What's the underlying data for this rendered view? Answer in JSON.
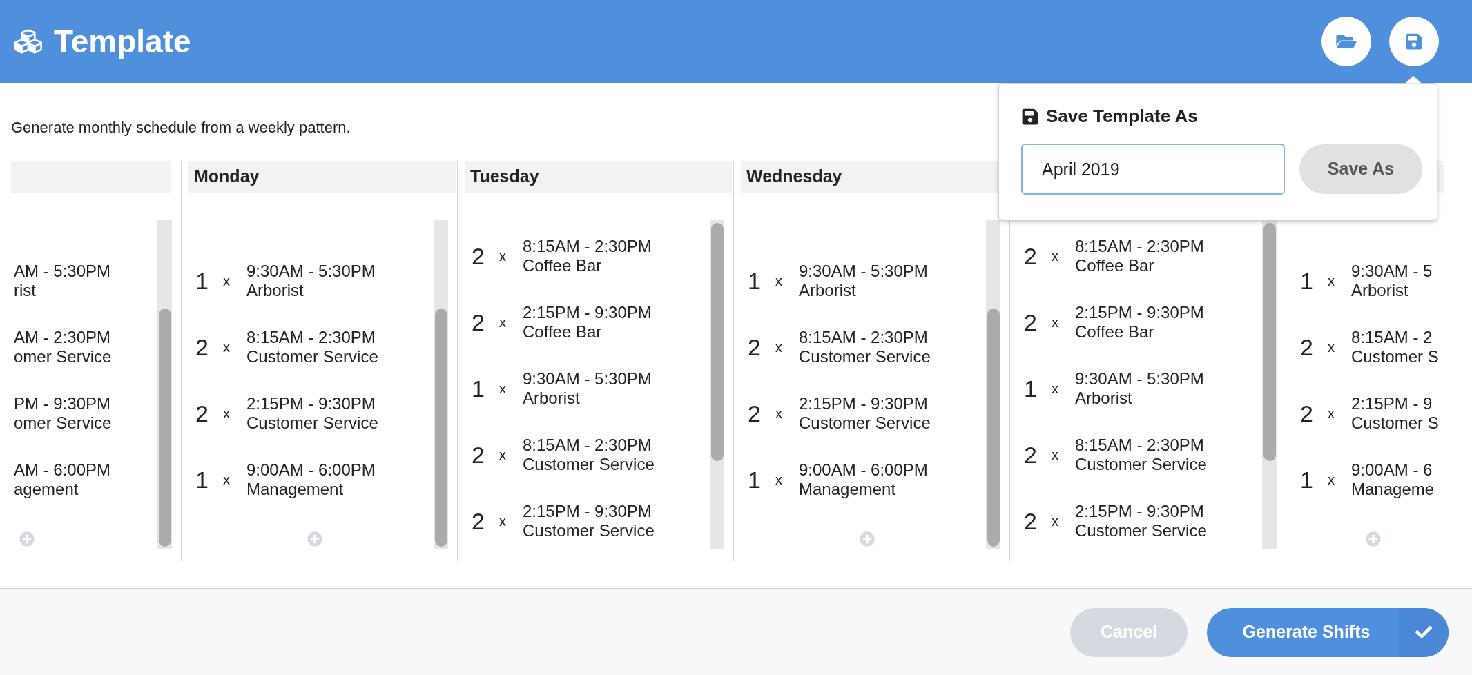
{
  "header": {
    "title": "Template"
  },
  "description": "Generate monthly schedule from a weekly pattern.",
  "columns": [
    {
      "kind": "clipped-left",
      "add_button": true,
      "shifts": [
        {
          "time": "AM - 5:30PM",
          "role": "rist"
        },
        {
          "time": "AM - 2:30PM",
          "role": "omer Service"
        },
        {
          "time": "PM - 9:30PM",
          "role": "omer Service"
        },
        {
          "time": "AM - 6:00PM",
          "role": "agement"
        }
      ]
    },
    {
      "kind": "full",
      "heading": "Monday",
      "add_button": true,
      "shifts": [
        {
          "count": "1",
          "multiplier": "x",
          "time": "9:30AM - 5:30PM",
          "role": "Arborist"
        },
        {
          "count": "2",
          "multiplier": "x",
          "time": "8:15AM - 2:30PM",
          "role": "Customer Service"
        },
        {
          "count": "2",
          "multiplier": "x",
          "time": "2:15PM - 9:30PM",
          "role": "Customer Service"
        },
        {
          "count": "1",
          "multiplier": "x",
          "time": "9:00AM - 6:00PM",
          "role": "Management"
        }
      ]
    },
    {
      "kind": "full",
      "heading": "Tuesday",
      "add_button": false,
      "shifts": [
        {
          "count": "2",
          "multiplier": "x",
          "time": "8:15AM - 2:30PM",
          "role": "Coffee Bar"
        },
        {
          "count": "2",
          "multiplier": "x",
          "time": "2:15PM - 9:30PM",
          "role": "Coffee Bar"
        },
        {
          "count": "1",
          "multiplier": "x",
          "time": "9:30AM - 5:30PM",
          "role": "Arborist"
        },
        {
          "count": "2",
          "multiplier": "x",
          "time": "8:15AM - 2:30PM",
          "role": "Customer Service"
        },
        {
          "count": "2",
          "multiplier": "x",
          "time": "2:15PM - 9:30PM",
          "role": "Customer Service"
        }
      ]
    },
    {
      "kind": "full",
      "heading": "Wednesday",
      "add_button": true,
      "shifts": [
        {
          "count": "1",
          "multiplier": "x",
          "time": "9:30AM - 5:30PM",
          "role": "Arborist"
        },
        {
          "count": "2",
          "multiplier": "x",
          "time": "8:15AM - 2:30PM",
          "role": "Customer Service"
        },
        {
          "count": "2",
          "multiplier": "x",
          "time": "2:15PM - 9:30PM",
          "role": "Customer Service"
        },
        {
          "count": "1",
          "multiplier": "x",
          "time": "9:00AM - 6:00PM",
          "role": "Management"
        }
      ]
    },
    {
      "kind": "full",
      "add_button": false,
      "shifts": [
        {
          "count": "2",
          "multiplier": "x",
          "time": "8:15AM - 2:30PM",
          "role": "Coffee Bar"
        },
        {
          "count": "2",
          "multiplier": "x",
          "time": "2:15PM - 9:30PM",
          "role": "Coffee Bar"
        },
        {
          "count": "1",
          "multiplier": "x",
          "time": "9:30AM - 5:30PM",
          "role": "Arborist"
        },
        {
          "count": "2",
          "multiplier": "x",
          "time": "8:15AM - 2:30PM",
          "role": "Customer Service"
        },
        {
          "count": "2",
          "multiplier": "x",
          "time": "2:15PM - 9:30PM",
          "role": "Customer Service"
        }
      ]
    },
    {
      "kind": "clipped-right",
      "add_button": true,
      "shifts": [
        {
          "count": "1",
          "multiplier": "x",
          "time": "9:30AM - 5",
          "role": "Arborist"
        },
        {
          "count": "2",
          "multiplier": "x",
          "time": "8:15AM - 2",
          "role": "Customer S"
        },
        {
          "count": "2",
          "multiplier": "x",
          "time": "2:15PM - 9",
          "role": "Customer S"
        },
        {
          "count": "1",
          "multiplier": "x",
          "time": "9:00AM - 6",
          "role": "Manageme"
        }
      ]
    }
  ],
  "save_popover": {
    "title": "Save Template As",
    "input_value": "April 2019",
    "button": "Save As"
  },
  "footer": {
    "cancel": "Cancel",
    "generate": "Generate Shifts"
  }
}
